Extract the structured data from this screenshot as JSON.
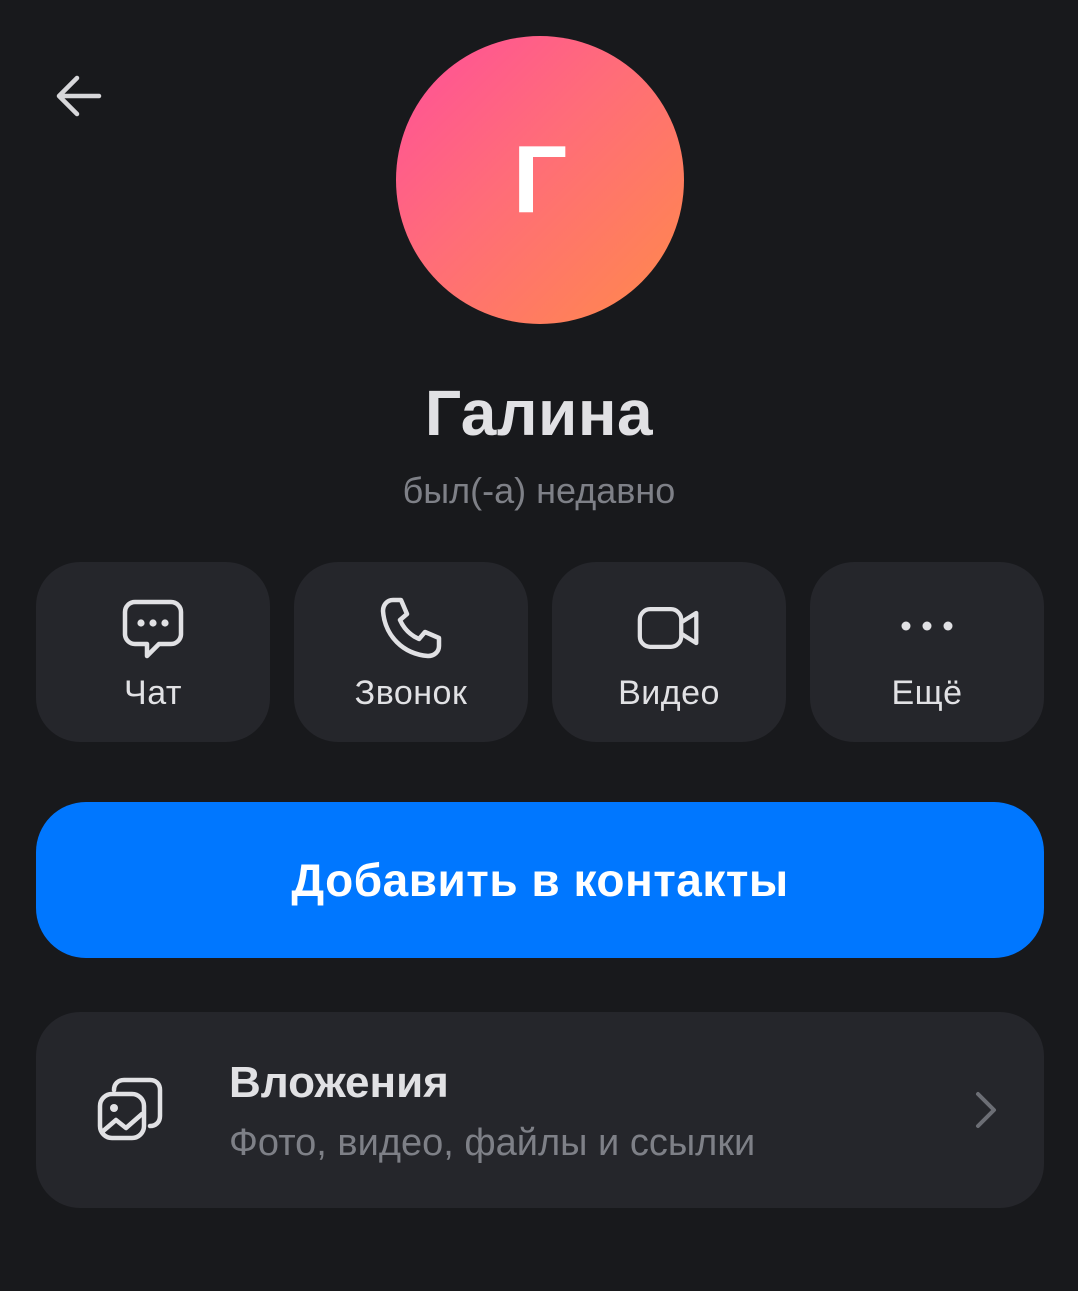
{
  "header": {
    "back_icon": "arrow-left-icon"
  },
  "profile": {
    "avatar_letter": "Г",
    "avatar_gradient": [
      "#ff4f9a",
      "#ff8a4a"
    ],
    "name": "Галина",
    "status": "был(-а) недавно"
  },
  "actions": [
    {
      "label": "Чат",
      "icon": "chat-bubble-icon"
    },
    {
      "label": "Звонок",
      "icon": "phone-icon"
    },
    {
      "label": "Видео",
      "icon": "video-camera-icon"
    },
    {
      "label": "Ещё",
      "icon": "more-dots-icon"
    }
  ],
  "add_contact": {
    "label": "Добавить в контакты",
    "color": "#0077ff"
  },
  "attachments": {
    "title": "Вложения",
    "subtitle": "Фото, видео, файлы и ссылки",
    "icon": "gallery-icon"
  },
  "colors": {
    "background": "#18191c",
    "card": "#25262b",
    "accent": "#0077ff",
    "secondary_text": "#7e8087"
  }
}
